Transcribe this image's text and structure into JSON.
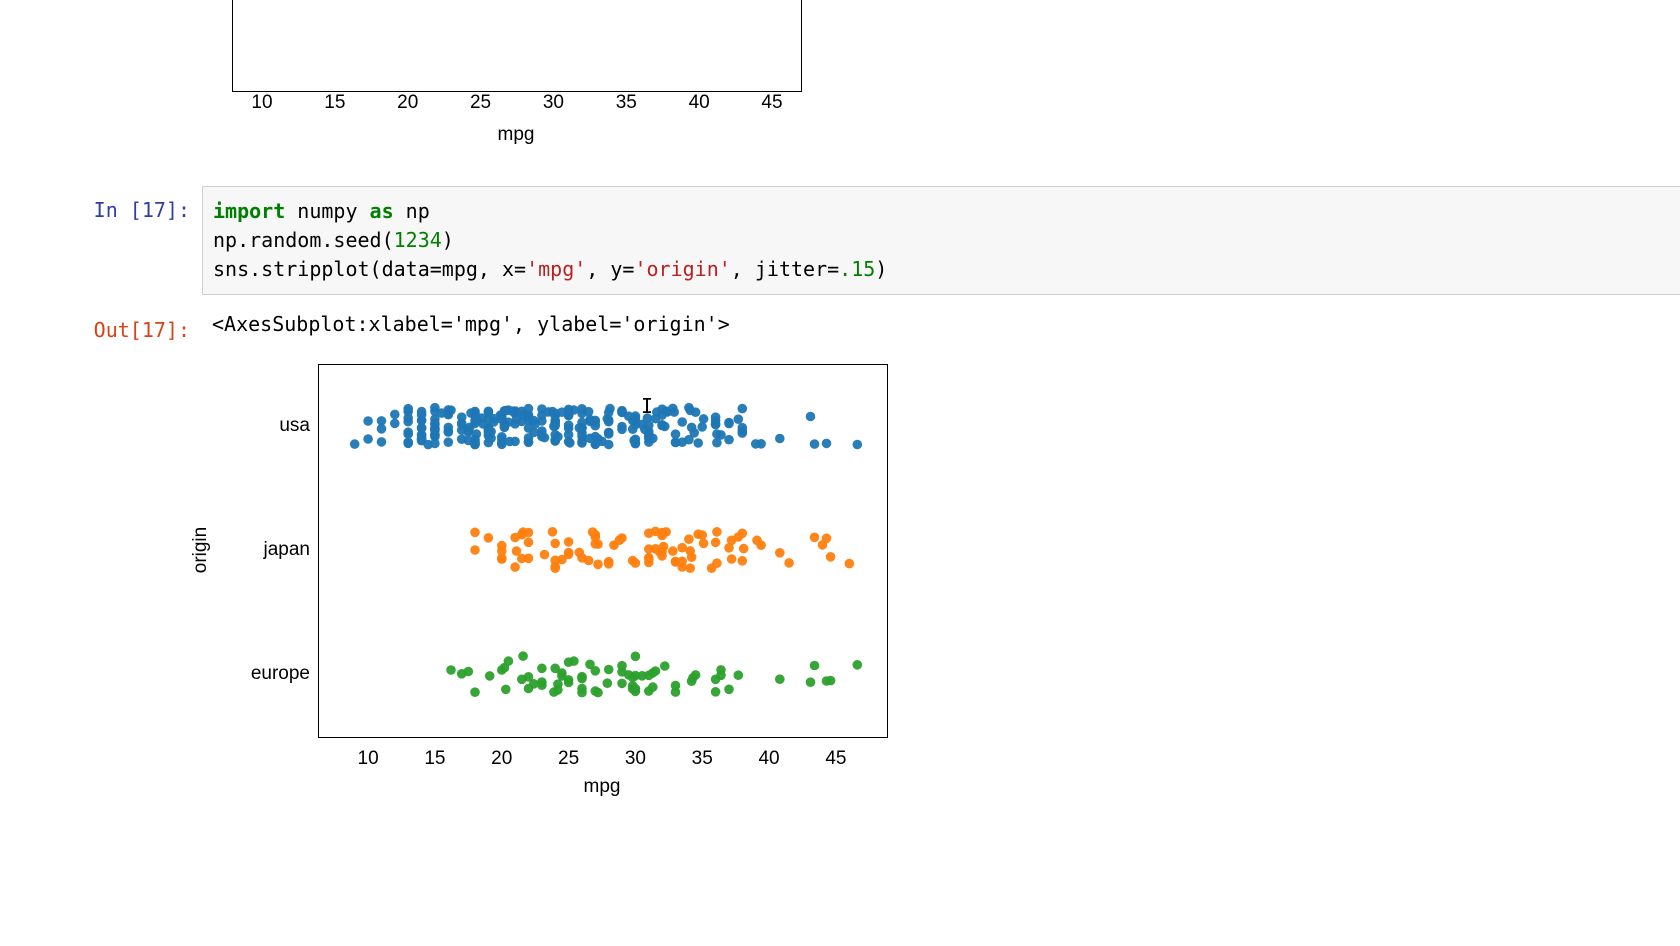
{
  "top_chart": {
    "xlabel": "mpg",
    "ticks": [
      10,
      15,
      20,
      25,
      30,
      35,
      40,
      45
    ]
  },
  "cell": {
    "in_prompt": "In [17]:",
    "out_prompt": "Out[17]:",
    "code": {
      "l1_kw1": "import",
      "l1_nm1": " numpy ",
      "l1_kw2": "as",
      "l1_nm2": " np",
      "l2": "np.random.seed(",
      "l2_num": "1234",
      "l2_end": ")",
      "l3a": "sns.stripplot(data=mpg, x=",
      "l3s1": "'mpg'",
      "l3b": ", y=",
      "l3s2": "'origin'",
      "l3c": ", jitter=",
      "l3_num": ".15",
      "l3d": ")"
    },
    "output_repr": "<AxesSubplot:xlabel='mpg', ylabel='origin'>"
  },
  "chart_data": {
    "type": "scatter",
    "xlabel": "mpg",
    "ylabel": "origin",
    "xlim": [
      7,
      48
    ],
    "x_ticks": [
      10,
      15,
      20,
      25,
      30,
      35,
      40,
      45
    ],
    "jitter": 0.15,
    "colors": {
      "usa": "#1f77b4",
      "japan": "#ff7f0e",
      "europe": "#2ca02c"
    },
    "categories": [
      "usa",
      "japan",
      "europe"
    ],
    "series": [
      {
        "name": "usa",
        "color": "#1f77b4",
        "values": [
          18,
          15,
          18,
          16,
          17,
          15,
          14,
          14,
          14,
          15,
          15,
          14,
          15,
          14,
          24,
          22,
          18,
          21,
          27,
          26,
          25,
          24,
          25,
          26,
          21,
          10,
          10,
          11,
          9,
          27,
          28,
          25,
          19,
          16,
          17,
          19,
          18,
          14,
          14,
          14,
          14,
          12,
          13,
          13,
          18,
          22,
          19,
          18,
          23,
          28,
          30,
          30,
          30,
          31,
          35,
          27,
          26,
          24,
          25,
          23,
          20,
          21,
          13,
          14,
          15,
          14,
          17,
          11,
          13,
          12,
          13,
          19,
          15,
          13,
          13,
          14,
          18,
          22,
          21,
          26,
          15,
          16,
          29,
          24,
          20,
          19,
          15,
          24,
          20,
          11,
          20,
          19,
          15,
          31,
          26,
          32,
          28,
          24,
          26,
          24,
          26,
          31,
          19,
          18,
          15,
          15,
          16,
          15,
          16,
          14,
          17,
          16,
          15,
          18,
          21,
          20,
          13,
          29,
          23,
          20,
          23,
          24,
          25,
          24,
          18,
          29,
          19,
          23,
          23,
          22,
          25,
          33,
          28,
          25,
          25,
          26,
          27,
          17.5,
          16,
          15.5,
          14.5,
          22,
          24,
          22.5,
          29,
          24.5,
          29,
          33,
          20,
          18,
          18.5,
          17.5,
          29.5,
          32,
          28,
          26.5,
          20,
          13,
          19,
          19,
          31,
          30.5,
          22,
          21.5,
          21.5,
          43.1,
          36.1,
          32.8,
          39.4,
          36.1,
          19.9,
          19.4,
          20.2,
          19.2,
          20.5,
          20.2,
          25.1,
          20.5,
          19.4,
          20.6,
          20.8,
          18.6,
          18.1,
          19.2,
          17.7,
          18.1,
          17.5,
          30,
          27.5,
          27.2,
          30.9,
          21.1,
          23.2,
          23.8,
          23.9,
          20.3,
          17,
          21.6,
          16.2,
          31.5,
          29.8,
          22.4,
          26.6,
          20.2,
          13,
          19.1,
          34.2,
          34.5,
          29.8,
          31.3,
          37,
          32.2,
          46.6,
          27.9,
          40.8,
          44.3,
          43.4,
          36.4,
          30,
          33.5,
          30,
          22,
          26.6,
          25.8,
          23.5,
          30,
          39,
          35.1,
          32.3,
          37,
          37.7,
          34.1,
          34.7,
          34.4,
          29.9,
          33,
          33.5,
          32.4,
          32.9,
          31.6,
          28.1,
          30.7,
          25.4,
          24.2,
          22.4,
          26.6,
          20.2,
          17.6,
          28,
          27,
          34,
          31,
          29,
          27,
          24,
          36,
          37,
          31,
          38,
          36,
          36,
          36,
          34,
          38,
          32,
          38,
          25,
          38,
          26,
          22,
          32,
          28
        ]
      },
      {
        "name": "japan",
        "color": "#ff7f0e",
        "values": [
          24,
          27,
          25,
          31,
          35,
          24,
          19,
          27,
          26,
          24,
          28,
          31,
          32,
          25,
          20,
          18,
          20,
          22,
          24,
          31,
          18,
          20,
          21,
          22,
          33,
          24.5,
          33.5,
          20,
          28,
          26.5,
          33.5,
          29,
          22,
          31.5,
          21.5,
          36.1,
          32.8,
          39.4,
          36.1,
          25.8,
          27.2,
          21.5,
          21.1,
          23.2,
          23.8,
          35.7,
          27.2,
          21.6,
          31.5,
          29.8,
          31,
          34.1,
          37.2,
          28.4,
          28.8,
          26.8,
          41.5,
          38.1,
          32.1,
          37.2,
          30,
          33,
          21,
          25,
          32,
          39.1,
          35.1,
          32.3,
          37,
          38,
          33.5,
          34.2,
          31.8,
          37.7,
          34.1,
          34.7,
          46,
          44.6,
          40.8,
          44.3,
          43.4,
          36,
          34,
          38,
          32,
          44,
          27,
          32,
          31
        ]
      },
      {
        "name": "europe",
        "color": "#2ca02c",
        "values": [
          26,
          25,
          24,
          25,
          26,
          30,
          22,
          28,
          30,
          30.5,
          22,
          26,
          20.5,
          18,
          17.5,
          27,
          29,
          27,
          31,
          36,
          36.4,
          43.1,
          29.5,
          21.5,
          23,
          20,
          25,
          29,
          24.5,
          29,
          33,
          23,
          24.5,
          26,
          31,
          23,
          30,
          36,
          25.4,
          24.2,
          34.3,
          29.8,
          31.3,
          37,
          32.2,
          46.6,
          27.9,
          40.8,
          44.3,
          43.4,
          36.4,
          30,
          44.6,
          37.7,
          33,
          27.2,
          23.9,
          20.3,
          17,
          21.6,
          16.2,
          31.5,
          29.8,
          22.4,
          26.6,
          20.2,
          19.1,
          34.2,
          34.5,
          29.8,
          31.3,
          24.2
        ]
      }
    ]
  }
}
